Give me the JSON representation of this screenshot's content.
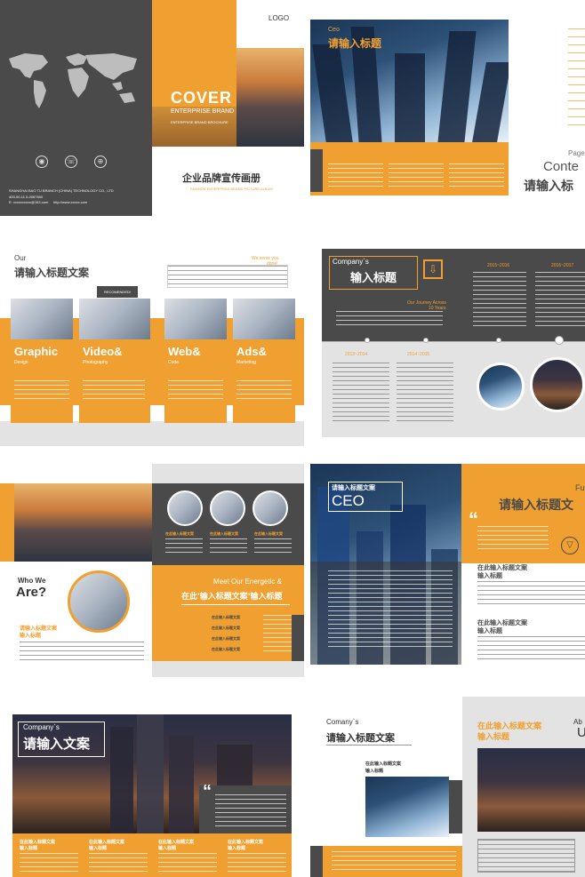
{
  "spread1": {
    "logo": "LOGO",
    "cover_title": "COVER",
    "cover_subtitle": "ENTERPRISE BRAND",
    "cover_small": "ENTERPRISE BRAND BROCHURE",
    "cn_title": "企业品牌宣传画册",
    "en_title": "FASHION ENTERPRISE BRAND PICTURE ALBUM",
    "company": "SHANGHAI BAO TU BRANCH (CHINA) TECHNOLOGY CO., LTD",
    "contact1": "400-00-11 0-0067800",
    "contact2": "E: xxxxxxxxxx@163.com",
    "contact3": "http://www.xxxxx.com",
    "icons": [
      "location-icon",
      "phone-icon",
      "globe-icon"
    ]
  },
  "spread2": {
    "ceo_label": "Ceo",
    "title": "请输入标题",
    "page_label": "Page",
    "contents_label": "Conte",
    "contents_title": "请输入标"
  },
  "spread3": {
    "our": "Our",
    "title": "请输入标题文案",
    "serve": "We serve you",
    "done": "done!",
    "recommended": "RECOMENDED!",
    "cards": [
      {
        "title": "Graphic",
        "sub": "Design"
      },
      {
        "title": "Video&",
        "sub": "Photography"
      },
      {
        "title": "Web&",
        "sub": "Code"
      },
      {
        "title": "Ads&",
        "sub": "Marketing"
      }
    ]
  },
  "spread4": {
    "company": "Company`s",
    "title": "输入标题",
    "journey": "Our Journey Across",
    "years": "10 Years",
    "years_top": [
      "2015~2016",
      "2016~2017"
    ],
    "years_bottom": [
      "2013~2014",
      "2014~2015"
    ]
  },
  "spread5": {
    "who": "Who We",
    "are": "Are?",
    "sub_title": "请输入标题文案",
    "sub_title2": "输入标题",
    "meet": "Meet Our Energetic &",
    "meet_cn": "在此'输入标题文案'输入标题",
    "team_labels": [
      "在此输入标题文案",
      "在此输入标题文案",
      "在此输入标题文案"
    ],
    "list": [
      "在此输入标题文案",
      "在此输入标题文案",
      "在此输入标题文案",
      "在此输入标题文案"
    ]
  },
  "spread6": {
    "tag": "请输入标题文案",
    "ceo": "CEO",
    "fu": "Fu",
    "title": "请输入标题文",
    "quote_mark": "“",
    "item1": "在此输入标题文案",
    "item1b": "输入标题",
    "item2": "在此输入标题文案",
    "item2b": "输入标题"
  },
  "spread7": {
    "company": "Company`s",
    "title": "请输入文案",
    "quote_mark": "“",
    "labels": [
      "在此输入标题文案",
      "在此输入标题文案",
      "在此输入标题文案",
      "在此输入标题文案"
    ],
    "labels2": [
      "输入标题",
      "输入标题",
      "输入标题",
      "输入标题"
    ]
  },
  "spread8": {
    "company": "Comany`s",
    "title": "请输入标题文案",
    "caption": "在此输入标题文案",
    "caption2": "输入标题",
    "about": "Ab",
    "orange_title": "在此输入标题文案",
    "orange_title2": "输入标题",
    "letter": "U"
  }
}
